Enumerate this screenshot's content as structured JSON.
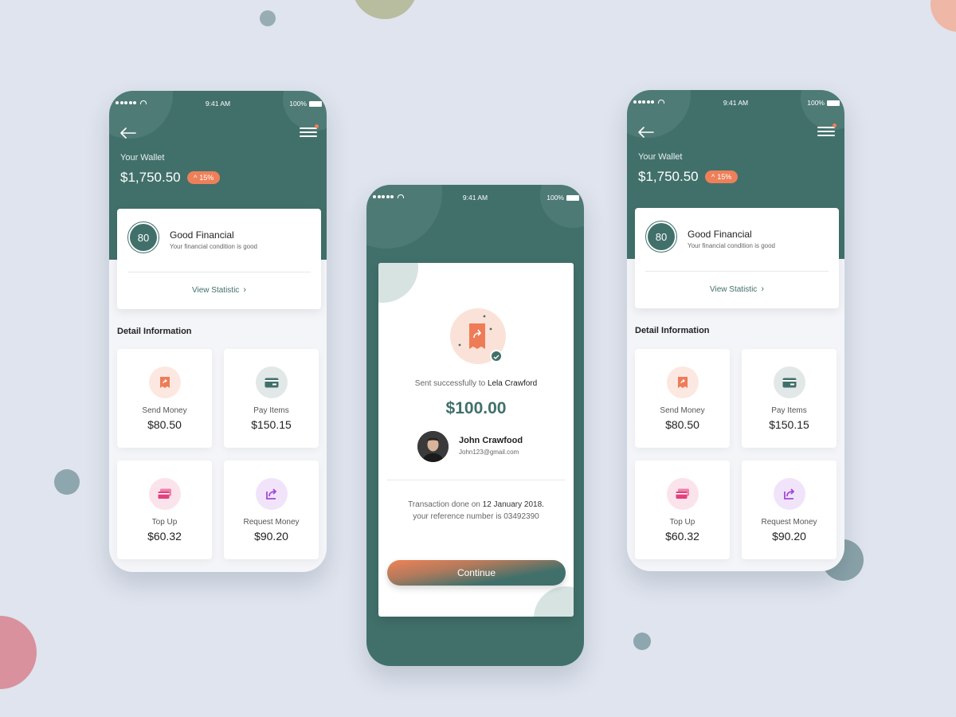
{
  "colors": {
    "background": "#dfe4ee",
    "primary": "#41706b",
    "accent": "#ee8059"
  },
  "status_bar": {
    "time": "9:41 AM",
    "battery": "100%"
  },
  "wallet_screen": {
    "wallet_label": "Your Wallet",
    "wallet_amount": "$1,750.50",
    "change_badge": "15%",
    "financial_card": {
      "score": "80",
      "title": "Good Financial",
      "subtitle": "Your financial condition is good",
      "link": "View Statistic"
    },
    "detail_title": "Detail Information",
    "tiles": [
      {
        "label": "Send Money",
        "value": "$80.50",
        "icon": "receipt-send-icon",
        "icon_color": "#ee7c57",
        "icon_bg": "#fce8e1"
      },
      {
        "label": "Pay Items",
        "value": "$150.15",
        "icon": "credit-card-icon",
        "icon_color": "#41706b",
        "icon_bg": "#e2e8e7"
      },
      {
        "label": "Top Up",
        "value": "$60.32",
        "icon": "cards-icon",
        "icon_color": "#e3407e",
        "icon_bg": "#fbe3ec"
      },
      {
        "label": "Request Money",
        "value": "$90.20",
        "icon": "share-icon",
        "icon_color": "#a24ad8",
        "icon_bg": "#f1e4fa"
      }
    ]
  },
  "success_screen": {
    "sent_prefix": "Sent successfully to",
    "recipient": "Lela Crawford",
    "amount": "$100.00",
    "person_name": "John Crawfood",
    "person_email": "John123@gmail.com",
    "tx_prefix": "Transaction done on",
    "tx_date": "12 January 2018.",
    "ref_text": "your reference number is 03492390",
    "continue_label": "Continue"
  }
}
